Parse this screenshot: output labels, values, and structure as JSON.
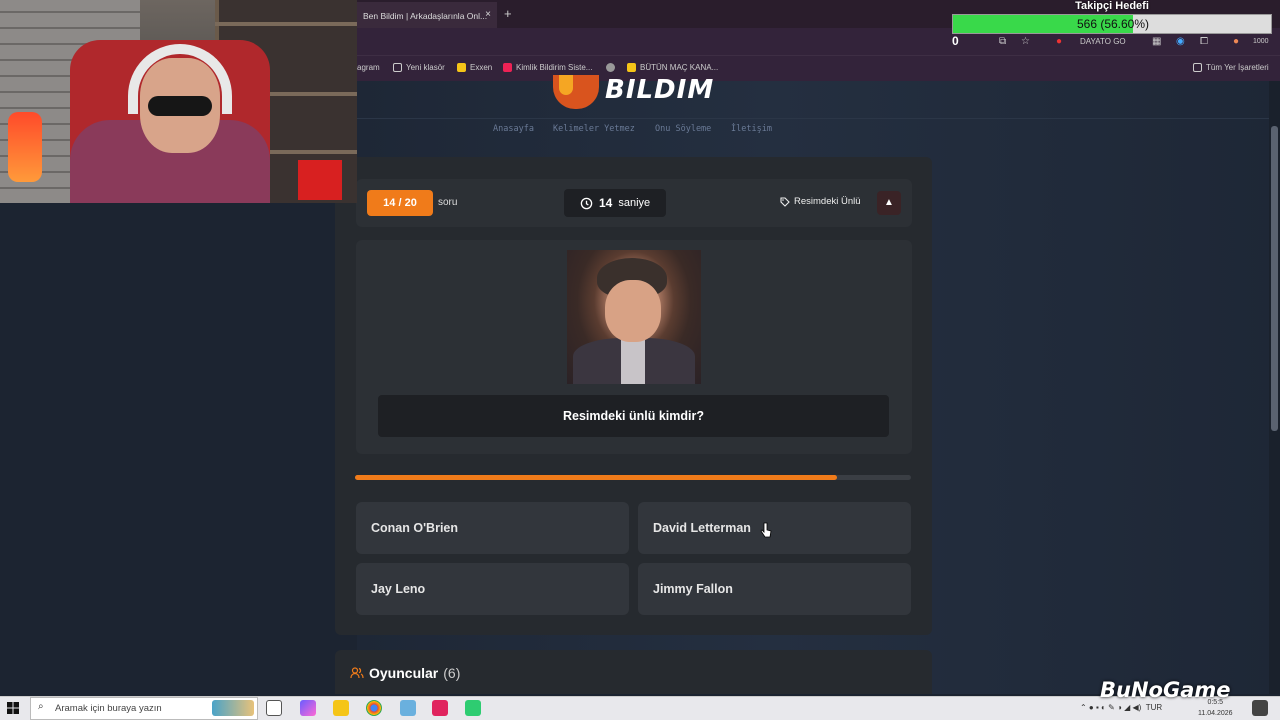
{
  "browser": {
    "tab_title": "Ben Bildim | Arkadaşlarınla Onl...",
    "tab_close": "×",
    "new_tab": "+",
    "bookmarks": [
      {
        "label": "agram"
      },
      {
        "label": "Yeni klasör"
      },
      {
        "label": "Exxen"
      },
      {
        "label": "Kimlik Bildirim Siste..."
      },
      {
        "label": ""
      },
      {
        "label": "BÜTÜN MAÇ KANA..."
      }
    ],
    "all_bookmarks": "Tüm Yer İşaretleri",
    "extension_label": "DAYATO GO",
    "badge_count": "1000"
  },
  "site": {
    "logo_text": "BILDIM",
    "nav": [
      "Anasayfa",
      "Kelimeler Yetmez",
      "Onu Söyleme",
      "İletişim"
    ]
  },
  "quiz": {
    "counter": "14 / 20",
    "counter_suffix": "soru",
    "timer_value": "14",
    "timer_unit": "saniye",
    "category": "Resimdeki Ünlü",
    "question": "Resimdeki ünlü kimdir?",
    "progress_fraction": 0.867,
    "answers": [
      "Conan O'Brien",
      "David Letterman",
      "Jay Leno",
      "Jimmy Fallon"
    ]
  },
  "players": {
    "title": "Oyuncular",
    "count": "(6)"
  },
  "overlay": {
    "title": "Takipçi Hedefi",
    "progress_text": "566 (56.60%)",
    "progress_fraction": 0.566,
    "counter": "0"
  },
  "taskbar": {
    "search_placeholder": "Aramak için buraya yazın",
    "language": "TUR",
    "time": "0:5:5",
    "date": "11.04.2026"
  },
  "watermark": "BuNoGame",
  "colors": {
    "accent": "#f07b1a",
    "card": "#2c3035",
    "answer_bg": "#32363c",
    "overlay_green": "#39d94a"
  }
}
